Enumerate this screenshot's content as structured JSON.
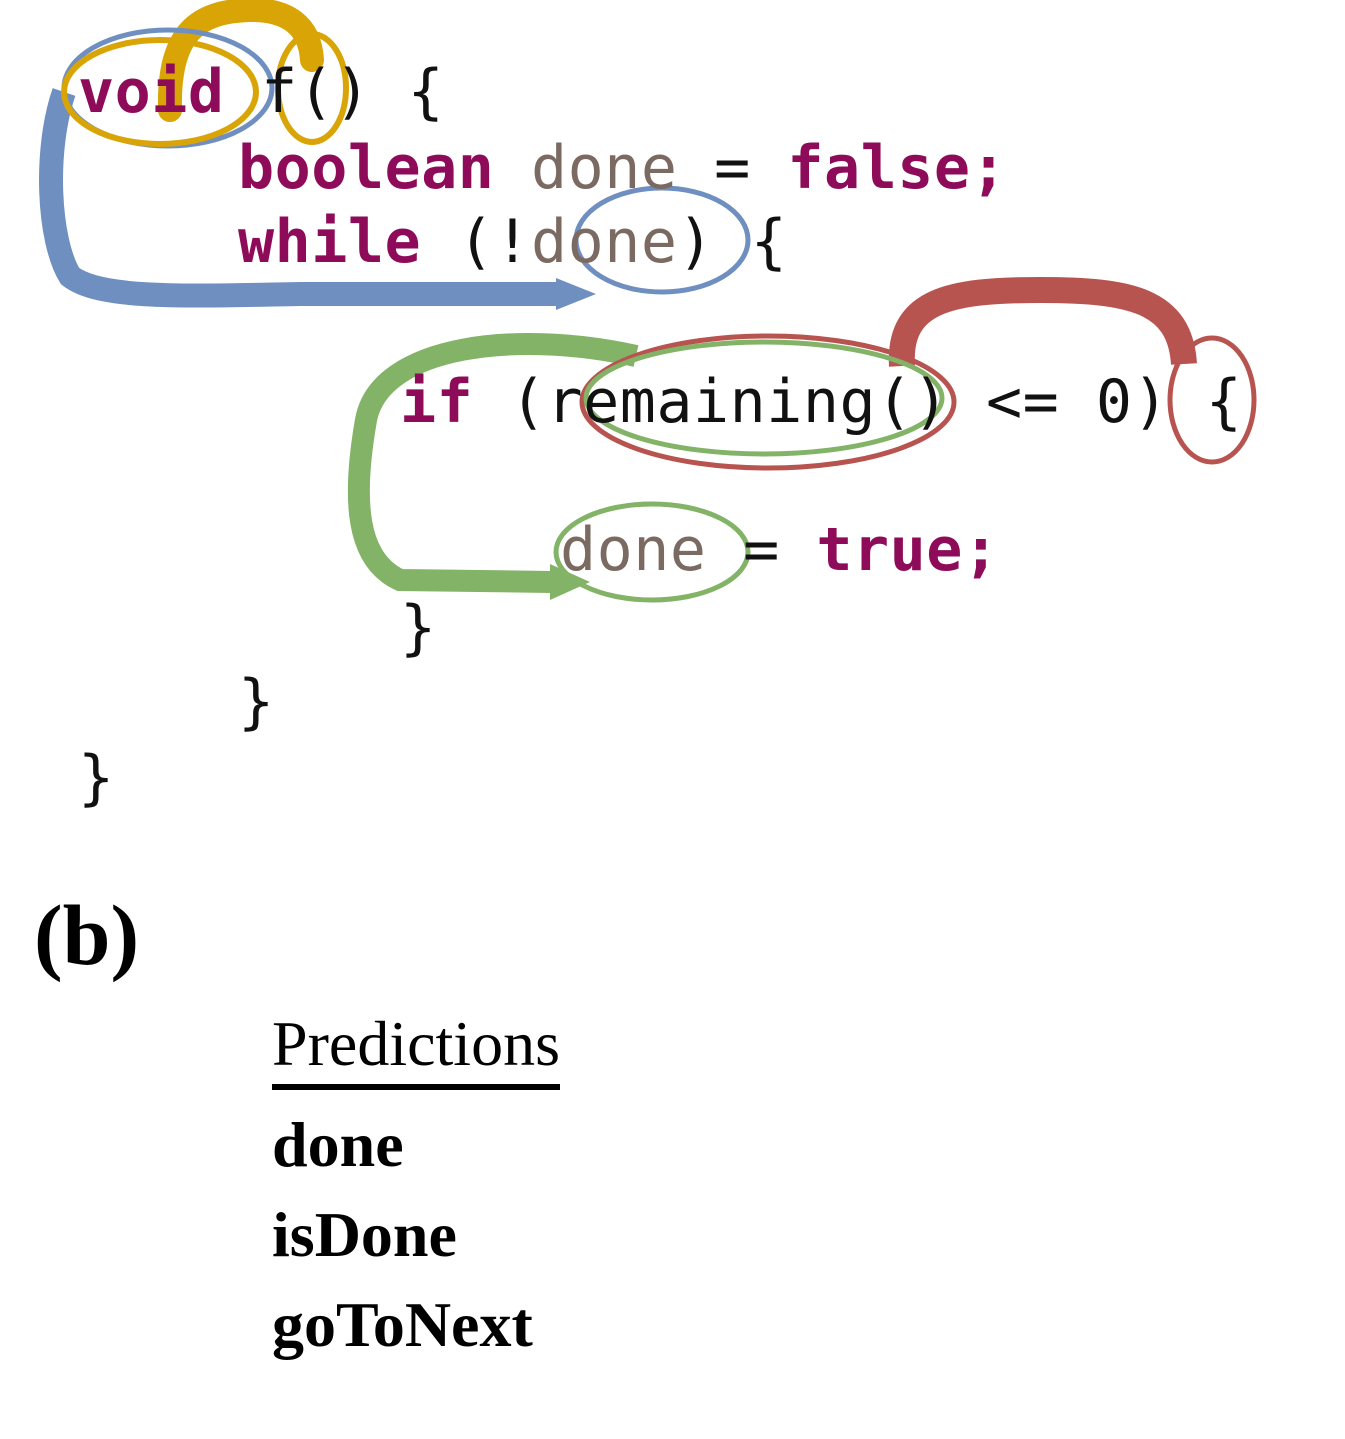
{
  "figure": {
    "panel_label": "(b)"
  },
  "code": {
    "language": "java",
    "lines": [
      {
        "id": "line-1",
        "tokens": [
          {
            "text": "void",
            "kind": "keyword"
          },
          {
            "text": " f() {",
            "kind": "plain"
          }
        ],
        "plain": "void f() {"
      },
      {
        "id": "line-2",
        "tokens": [
          {
            "text": "boolean",
            "kind": "keyword"
          },
          {
            "text": " ",
            "kind": "plain"
          },
          {
            "text": "done",
            "kind": "identifier"
          },
          {
            "text": " = ",
            "kind": "plain"
          },
          {
            "text": "false",
            "kind": "keyword"
          },
          {
            "text": ";",
            "kind": "keyword"
          }
        ],
        "plain": "boolean done = false;"
      },
      {
        "id": "line-3",
        "tokens": [
          {
            "text": "while",
            "kind": "keyword"
          },
          {
            "text": " (!",
            "kind": "plain"
          },
          {
            "text": "done",
            "kind": "identifier"
          },
          {
            "text": ") {",
            "kind": "plain"
          }
        ],
        "plain": "while (!done) {"
      },
      {
        "id": "line-4",
        "tokens": [
          {
            "text": "if",
            "kind": "keyword"
          },
          {
            "text": " (",
            "kind": "plain"
          },
          {
            "text": "remaining",
            "kind": "plain"
          },
          {
            "text": "() <= 0) {",
            "kind": "plain"
          }
        ],
        "plain": "if (remaining() <= 0) {"
      },
      {
        "id": "line-5",
        "tokens": [
          {
            "text": "done",
            "kind": "identifier"
          },
          {
            "text": " = ",
            "kind": "plain"
          },
          {
            "text": "true",
            "kind": "keyword"
          },
          {
            "text": ";",
            "kind": "keyword"
          }
        ],
        "plain": "done = true;"
      },
      {
        "id": "line-6",
        "tokens": [
          {
            "text": "}",
            "kind": "plain"
          }
        ],
        "plain": "}"
      },
      {
        "id": "line-7",
        "tokens": [
          {
            "text": "}",
            "kind": "plain"
          }
        ],
        "plain": "}"
      },
      {
        "id": "line-8",
        "tokens": [
          {
            "text": "}",
            "kind": "plain"
          }
        ],
        "plain": "}"
      }
    ]
  },
  "annotations": {
    "colors": {
      "gold": "#D9A406",
      "blue": "#6E8FC0",
      "red": "#B85450",
      "green": "#82B366",
      "keyword": "#8E0B5A",
      "identifier": "#7A6A62",
      "plain": "#111111"
    },
    "ellipses": [
      {
        "name": "gold-ellipse-void",
        "target": "void",
        "color": "gold"
      },
      {
        "name": "gold-ellipse-f",
        "target": "f",
        "color": "gold"
      },
      {
        "name": "blue-ellipse-void",
        "target": "void",
        "color": "blue"
      },
      {
        "name": "blue-ellipse-done",
        "target": "done",
        "color": "blue"
      },
      {
        "name": "red-ellipse-remaining",
        "target": "remaining",
        "color": "red"
      },
      {
        "name": "red-ellipse-zero",
        "target": "0",
        "color": "red"
      },
      {
        "name": "green-ellipse-remaining",
        "target": "remaining",
        "color": "green"
      },
      {
        "name": "green-ellipse-done",
        "target": "done",
        "color": "green"
      }
    ],
    "arcs": [
      {
        "name": "gold-arc-void-to-f",
        "from": "void",
        "to": "f",
        "color": "gold"
      },
      {
        "name": "blue-arc-void-to-done",
        "from": "void",
        "to": "done",
        "color": "blue"
      },
      {
        "name": "red-arc-remaining-to-zero",
        "from": "remaining",
        "to": "0",
        "color": "red"
      },
      {
        "name": "green-arc-remaining-to-done",
        "from": "remaining",
        "to": "done",
        "color": "green"
      }
    ]
  },
  "predictions": {
    "heading": "Predictions",
    "items": [
      "done",
      "isDone",
      "goToNext"
    ]
  }
}
